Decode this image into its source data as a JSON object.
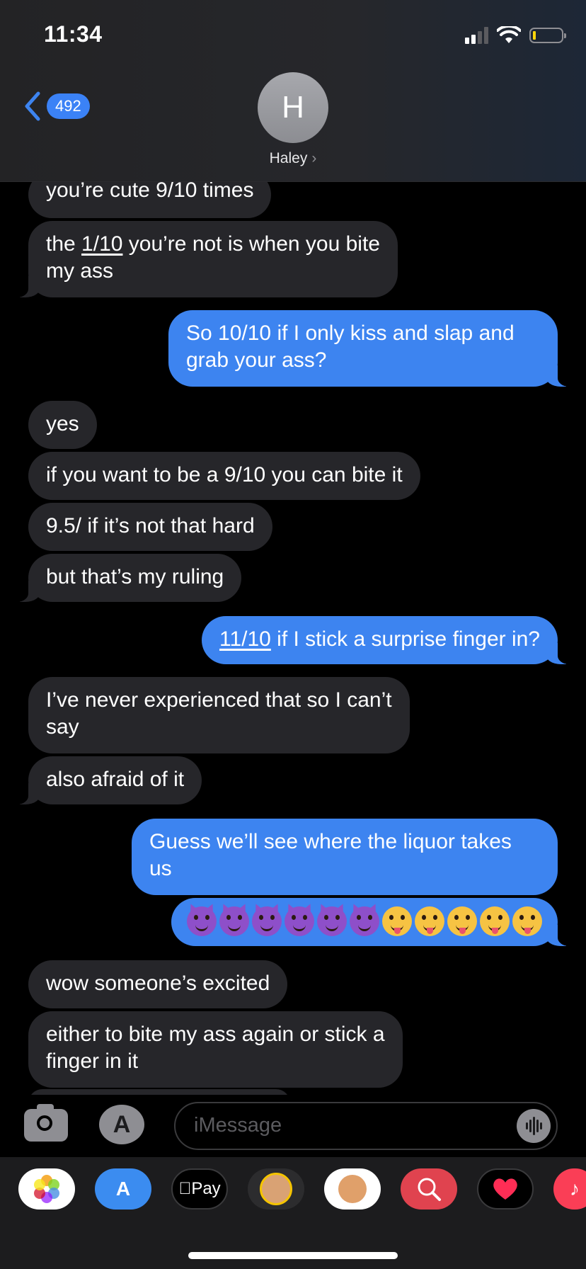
{
  "status_bar": {
    "time": "11:34"
  },
  "header": {
    "back_count": "492",
    "avatar_initial": "H",
    "contact_name": "Haley"
  },
  "messages": [
    {
      "dir": "in",
      "parts": [
        "you’re cute 9/10 times"
      ]
    },
    {
      "dir": "in",
      "line1_pre": "the ",
      "line1_link": "1/10",
      "line1_post": " you’re not is when you bite",
      "line2": "my ass"
    },
    {
      "dir": "out",
      "line1": "So 10/10 if I only kiss and slap and",
      "line2": "grab your ass?"
    },
    {
      "dir": "in",
      "text": "yes"
    },
    {
      "dir": "in",
      "text": "if you want to be a 9/10 you can bite it"
    },
    {
      "dir": "in",
      "text": "9.5/ if it’s not that hard"
    },
    {
      "dir": "in",
      "text": "but that’s my ruling"
    },
    {
      "dir": "out",
      "link": "11/10",
      "post": " if I stick a surprise finger in?"
    },
    {
      "dir": "in",
      "line1": "I’ve never experienced that so I can’t",
      "line2": "say"
    },
    {
      "dir": "in",
      "text": "also afraid of it"
    },
    {
      "dir": "out",
      "line1": "Guess we’ll see where the liquor takes",
      "line2": "us"
    },
    {
      "dir": "out",
      "emojis": [
        "smiling-imp",
        "smiling-imp",
        "smiling-imp",
        "smiling-imp",
        "smiling-imp",
        "smiling-imp",
        "tongue-face",
        "tongue-face",
        "tongue-face",
        "tongue-face",
        "tongue-face"
      ]
    },
    {
      "dir": "in",
      "text": "wow someone’s excited"
    },
    {
      "dir": "in",
      "line1": "either to bite my ass again or stick a",
      "line2": "finger in it"
    }
  ],
  "input": {
    "placeholder": "iMessage"
  },
  "drawer": {
    "apple_pay_label": "Pay"
  },
  "colors": {
    "incoming": "#26262a",
    "outgoing": "#3d84f0",
    "background": "#000000"
  }
}
